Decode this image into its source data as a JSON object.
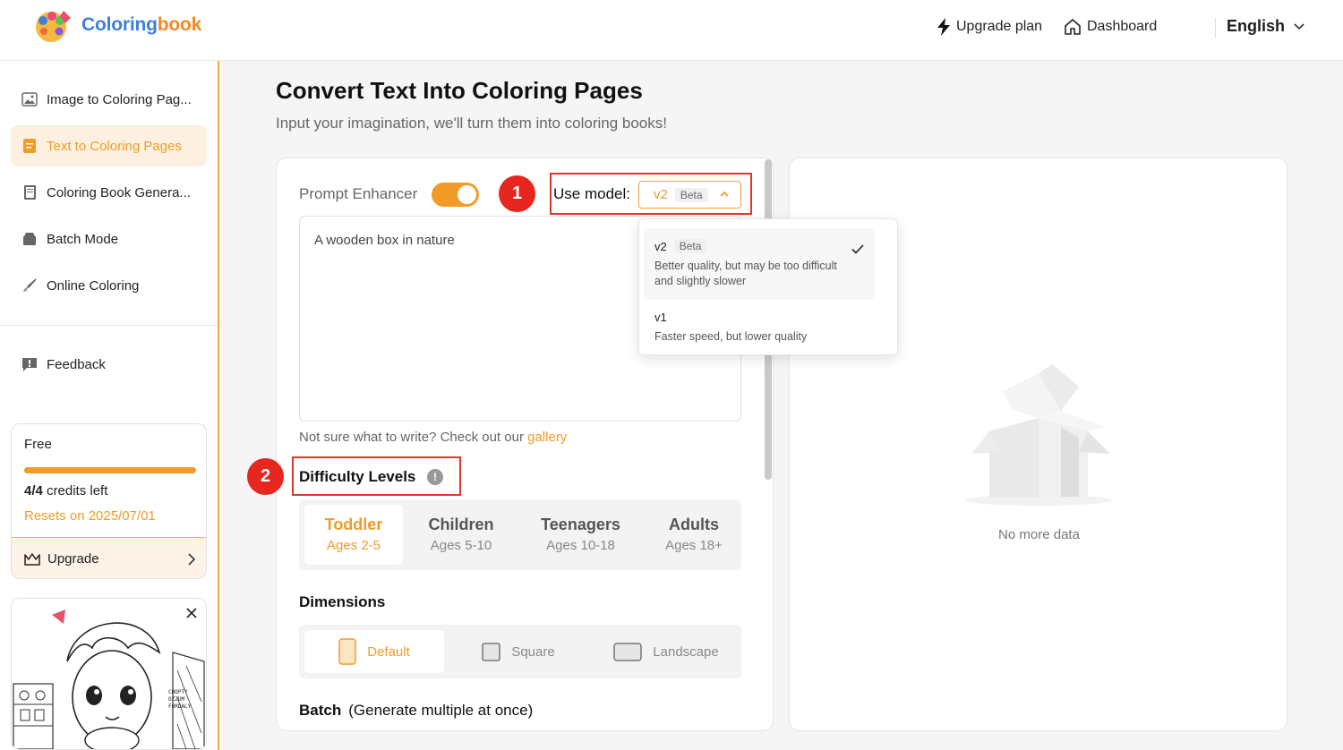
{
  "header": {
    "logo_text_part1": "Coloring",
    "logo_text_part2": "book",
    "upgrade_plan": "Upgrade plan",
    "dashboard": "Dashboard",
    "language": "English"
  },
  "sidebar": {
    "items": [
      {
        "label": "Image to Coloring Pag...",
        "icon": "image-icon"
      },
      {
        "label": "Text to Coloring Pages",
        "icon": "document-icon",
        "active": true
      },
      {
        "label": "Coloring Book Genera...",
        "icon": "book-icon"
      },
      {
        "label": "Batch Mode",
        "icon": "stack-icon"
      },
      {
        "label": "Online Coloring",
        "icon": "brush-icon"
      }
    ],
    "feedback": "Feedback",
    "plan": {
      "title": "Free",
      "credits_used": "4/4",
      "credits_suffix": "credits left",
      "credits_fraction": 1.0,
      "reset": "Resets on 2025/07/01",
      "upgrade": "Upgrade"
    }
  },
  "main": {
    "title": "Convert Text Into Coloring Pages",
    "subtitle": "Input your imagination, we'll turn them into coloring books!",
    "prompt_enhancer_label": "Prompt Enhancer",
    "prompt_enhancer_on": true,
    "model_label": "Use model:",
    "model_selected": "v2",
    "model_selected_tag": "Beta",
    "prompt_text": "A wooden box in nature",
    "hint_prefix": "Not sure what to write? Check out our",
    "hint_link": "gallery",
    "difficulty_heading": "Difficulty Levels",
    "difficulty_info": "!",
    "difficulty": [
      {
        "name": "Toddler",
        "ages": "Ages 2-5",
        "active": true
      },
      {
        "name": "Children",
        "ages": "Ages 5-10"
      },
      {
        "name": "Teenagers",
        "ages": "Ages 10-18"
      },
      {
        "name": "Adults",
        "ages": "Ages 18+"
      }
    ],
    "dimensions_heading": "Dimensions",
    "dimensions": [
      {
        "name": "Default",
        "active": true
      },
      {
        "name": "Square"
      },
      {
        "name": "Landscape"
      }
    ],
    "batch_heading": "Batch",
    "batch_sub": "(Generate multiple at once)"
  },
  "dropdown": {
    "options": [
      {
        "name": "v2",
        "tag": "Beta",
        "desc_line1": "Better quality, but may be too difficult",
        "desc_line2": "and slightly slower",
        "selected": true
      },
      {
        "name": "v1",
        "desc_line1": "Faster speed, but lower quality"
      }
    ]
  },
  "result": {
    "empty_text": "No more data"
  },
  "annotations": {
    "badge1": "1",
    "badge2": "2"
  },
  "colors": {
    "accent": "#f29c27",
    "annotation_red": "#e0372a"
  }
}
